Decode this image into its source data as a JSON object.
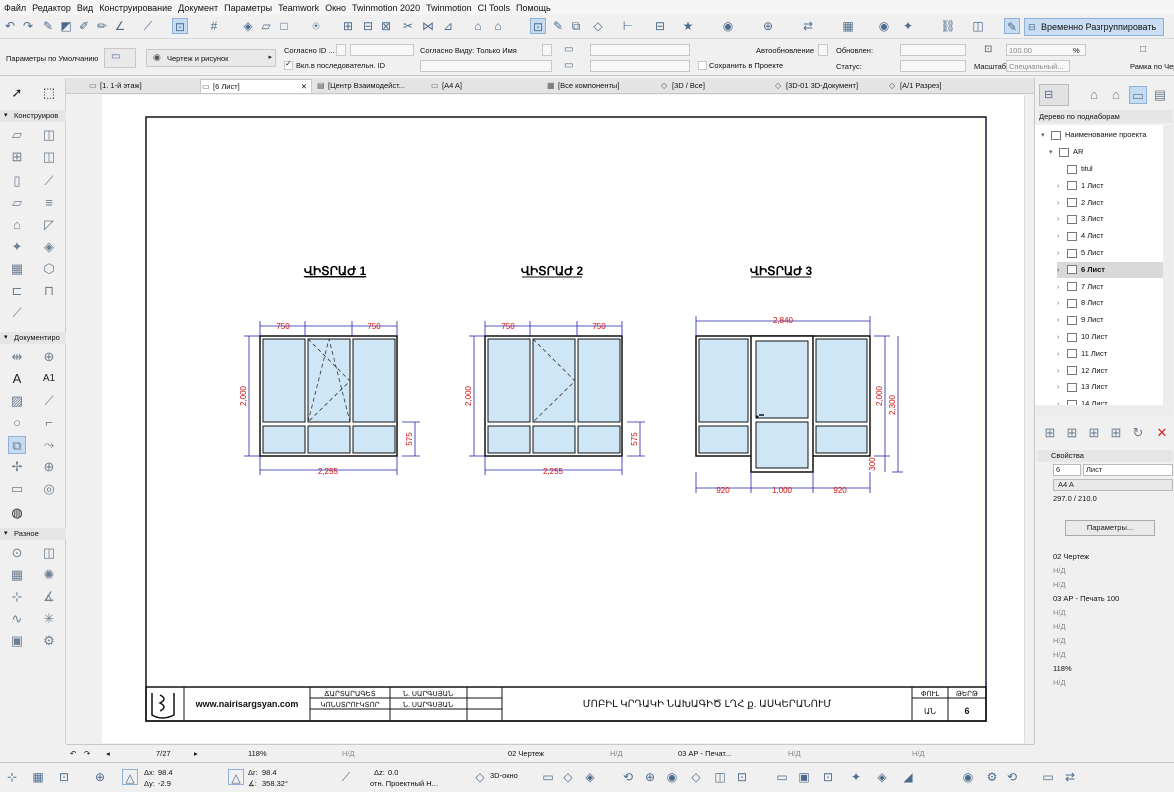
{
  "menu": [
    "Файл",
    "Редактор",
    "Вид",
    "Конструирование",
    "Документ",
    "Параметры",
    "Teamwork",
    "Окно",
    "Twinmotion 2020",
    "Twinmotion",
    "CI Tools",
    "Помощь"
  ],
  "toolbar": {
    "regroup_label": "Временно Разгруппировать"
  },
  "infobox": {
    "defaults": "Параметры по Умолчанию",
    "drawing_mode": "Чертеж и рисунок",
    "id_label": "Согласно ID ...",
    "seq_label": "Вкл.в последовательн. ID",
    "view_label": "Согласно Виду: Только Имя",
    "save_label": "Сохранить в Проекте",
    "auto_label": "Автообновление",
    "updated_label": "Обновлен:",
    "status_label": "Статус:",
    "scale_label": "Масштаб",
    "zoom_value": "100.00",
    "zoom_unit": "%",
    "special_label": "Специальный...",
    "frame_label": "Рамка по Чер"
  },
  "toolbox": {
    "section_design": "Конструиров",
    "section_doc": "Документиро",
    "section_misc": "Разное",
    "text_tool": "A",
    "label_tool": "A1"
  },
  "tabs": [
    {
      "label": "[1. 1-й этаж]",
      "icon": "▭"
    },
    {
      "label": "[6 Лист]",
      "icon": "▭"
    },
    {
      "label": "[Центр Взаимодейст...",
      "icon": "▤"
    },
    {
      "label": "[A4 A]",
      "icon": "▭"
    },
    {
      "label": "[Все компоненты]",
      "icon": "▦"
    },
    {
      "label": "[3D / Все]",
      "icon": "◇"
    },
    {
      "label": "[3D-01 3D-Документ]",
      "icon": "◇"
    },
    {
      "label": "[A/1 Разрез]",
      "icon": "◇"
    }
  ],
  "sheet": {
    "titles": [
      "ՎԻՏՐԱԺ 1",
      "ՎԻՏՐԱԺ 2",
      "ՎԻՏՐԱԺ 3"
    ],
    "dims": {
      "w1_left": "750",
      "w1_right": "750",
      "w1_height": "2,000",
      "w1_low": "575",
      "w1_total": "2,255",
      "w2_left": "750",
      "w2_right": "750",
      "w2_height": "2,000",
      "w2_low": "575",
      "w2_total": "2,255",
      "w3_top": "2,840",
      "w3_height": "2,000",
      "w3_total_h": "2,300",
      "w3_sill": "300",
      "w3_left": "920",
      "w3_mid": "1,000",
      "w3_right": "920"
    },
    "stamp": {
      "website": "www.nairisargsyan.com",
      "row1_role": "ՃԱՐՏԱՐԱԳԵՏ",
      "row1_name": "Ն. ՍԱՐԳՍՅԱՆ",
      "row2_role": "ԿՈՆՍՏՐՈՒԿՏՈՐ",
      "row2_name": "Ն. ՍԱՐԳՍՅԱՆ",
      "project": "ՄՈԲԻԼ ԿՐԴԱԿԻ ՆԱԽԱԳԻԾ ԼՂՀ ք. ԱՍԿԵՐԱՆՈՒՄ",
      "col_phase": "ՓՈՒԼ",
      "col_sheet": "ԹԵՐԹ",
      "phase_value": "ԱՆ",
      "sheet_value": "6"
    }
  },
  "navigator": {
    "header": "Дерево по поднаборам",
    "root": "Наименование проекта",
    "folder": "AR",
    "items": [
      "titul",
      "1 Лист",
      "2 Лист",
      "3 Лист",
      "4 Лист",
      "5 Лист",
      "6 Лист",
      "7 Лист",
      "8 Лист",
      "9 Лист",
      "10 Лист",
      "11 Лист",
      "12 Лист",
      "13 Лист",
      "14 Лист"
    ],
    "selected_index": 6
  },
  "properties": {
    "header": "Свойства",
    "number": "6",
    "name": "Лист",
    "format": "A4 A",
    "size": "297.0 / 210.0",
    "params_button": "Параметры...",
    "layer": "02 Чертеж",
    "na": "Н/Д",
    "pen": "03 АР - Печать 100",
    "zoom": "118%"
  },
  "status": {
    "page": "7/27",
    "zoom": "118%",
    "na1": "Н/Д",
    "layer": "02 Чертеж",
    "na2": "Н/Д",
    "pen": "03 АР - Печат...",
    "na3": "Н/Д",
    "na4": "Н/Д"
  },
  "coords": {
    "dx_label": "Δx:",
    "dx": "98.4",
    "dy_label": "Δy:",
    "dy": "-2.9",
    "dr_label": "Δr:",
    "dr": "98.4",
    "da_label": "∡:",
    "da": "358.32°",
    "dz_label": "Δz:",
    "dz": "0.0",
    "ref_label": "отн. Проектный Н...",
    "view3d": "3D-окно"
  }
}
